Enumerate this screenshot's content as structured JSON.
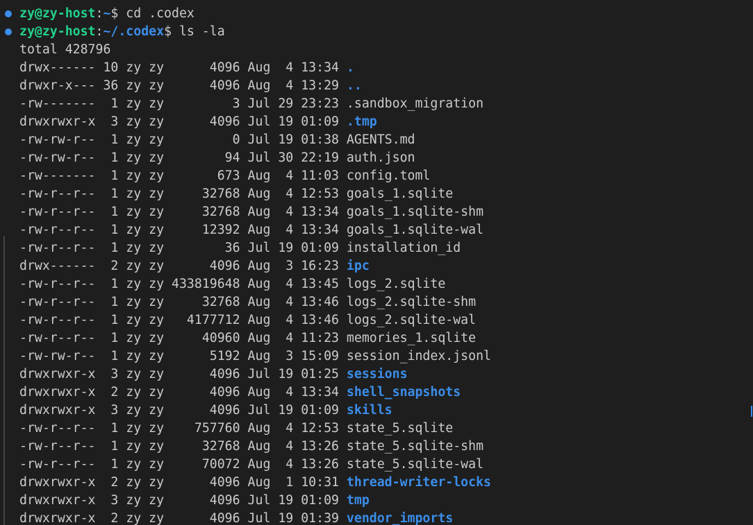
{
  "prompt": {
    "user_host": "zy@zy-host",
    "sep": ":"
  },
  "commands": [
    {
      "path": "~",
      "cmd": "$ cd .codex"
    },
    {
      "path": "~/.codex",
      "cmd": "$ ls -la"
    }
  ],
  "total_line": "total 428796",
  "entries": [
    {
      "perm": "drwx------",
      "links": "10",
      "owner": "zy",
      "group": "zy",
      "size": "4096",
      "month": "Aug",
      "day": "4",
      "time": "13:34",
      "name": ".",
      "is_dir": true
    },
    {
      "perm": "drwxr-x---",
      "links": "36",
      "owner": "zy",
      "group": "zy",
      "size": "4096",
      "month": "Aug",
      "day": "4",
      "time": "13:29",
      "name": "..",
      "is_dir": true
    },
    {
      "perm": "-rw-------",
      "links": "1",
      "owner": "zy",
      "group": "zy",
      "size": "3",
      "month": "Jul",
      "day": "29",
      "time": "23:23",
      "name": ".sandbox_migration",
      "is_dir": false
    },
    {
      "perm": "drwxrwxr-x",
      "links": "3",
      "owner": "zy",
      "group": "zy",
      "size": "4096",
      "month": "Jul",
      "day": "19",
      "time": "01:09",
      "name": ".tmp",
      "is_dir": true
    },
    {
      "perm": "-rw-rw-r--",
      "links": "1",
      "owner": "zy",
      "group": "zy",
      "size": "0",
      "month": "Jul",
      "day": "19",
      "time": "01:38",
      "name": "AGENTS.md",
      "is_dir": false
    },
    {
      "perm": "-rw-rw-r--",
      "links": "1",
      "owner": "zy",
      "group": "zy",
      "size": "94",
      "month": "Jul",
      "day": "30",
      "time": "22:19",
      "name": "auth.json",
      "is_dir": false
    },
    {
      "perm": "-rw-------",
      "links": "1",
      "owner": "zy",
      "group": "zy",
      "size": "673",
      "month": "Aug",
      "day": "4",
      "time": "11:03",
      "name": "config.toml",
      "is_dir": false
    },
    {
      "perm": "-rw-r--r--",
      "links": "1",
      "owner": "zy",
      "group": "zy",
      "size": "32768",
      "month": "Aug",
      "day": "4",
      "time": "12:53",
      "name": "goals_1.sqlite",
      "is_dir": false
    },
    {
      "perm": "-rw-r--r--",
      "links": "1",
      "owner": "zy",
      "group": "zy",
      "size": "32768",
      "month": "Aug",
      "day": "4",
      "time": "13:34",
      "name": "goals_1.sqlite-shm",
      "is_dir": false
    },
    {
      "perm": "-rw-r--r--",
      "links": "1",
      "owner": "zy",
      "group": "zy",
      "size": "12392",
      "month": "Aug",
      "day": "4",
      "time": "13:34",
      "name": "goals_1.sqlite-wal",
      "is_dir": false
    },
    {
      "perm": "-rw-r--r--",
      "links": "1",
      "owner": "zy",
      "group": "zy",
      "size": "36",
      "month": "Jul",
      "day": "19",
      "time": "01:09",
      "name": "installation_id",
      "is_dir": false
    },
    {
      "perm": "drwx------",
      "links": "2",
      "owner": "zy",
      "group": "zy",
      "size": "4096",
      "month": "Aug",
      "day": "3",
      "time": "16:23",
      "name": "ipc",
      "is_dir": true
    },
    {
      "perm": "-rw-r--r--",
      "links": "1",
      "owner": "zy",
      "group": "zy",
      "size": "433819648",
      "month": "Aug",
      "day": "4",
      "time": "13:45",
      "name": "logs_2.sqlite",
      "is_dir": false
    },
    {
      "perm": "-rw-r--r--",
      "links": "1",
      "owner": "zy",
      "group": "zy",
      "size": "32768",
      "month": "Aug",
      "day": "4",
      "time": "13:46",
      "name": "logs_2.sqlite-shm",
      "is_dir": false
    },
    {
      "perm": "-rw-r--r--",
      "links": "1",
      "owner": "zy",
      "group": "zy",
      "size": "4177712",
      "month": "Aug",
      "day": "4",
      "time": "13:46",
      "name": "logs_2.sqlite-wal",
      "is_dir": false
    },
    {
      "perm": "-rw-r--r--",
      "links": "1",
      "owner": "zy",
      "group": "zy",
      "size": "40960",
      "month": "Aug",
      "day": "4",
      "time": "11:23",
      "name": "memories_1.sqlite",
      "is_dir": false
    },
    {
      "perm": "-rw-rw-r--",
      "links": "1",
      "owner": "zy",
      "group": "zy",
      "size": "5192",
      "month": "Aug",
      "day": "3",
      "time": "15:09",
      "name": "session_index.jsonl",
      "is_dir": false
    },
    {
      "perm": "drwxrwxr-x",
      "links": "3",
      "owner": "zy",
      "group": "zy",
      "size": "4096",
      "month": "Jul",
      "day": "19",
      "time": "01:25",
      "name": "sessions",
      "is_dir": true
    },
    {
      "perm": "drwxrwxr-x",
      "links": "2",
      "owner": "zy",
      "group": "zy",
      "size": "4096",
      "month": "Aug",
      "day": "4",
      "time": "13:34",
      "name": "shell_snapshots",
      "is_dir": true
    },
    {
      "perm": "drwxrwxr-x",
      "links": "3",
      "owner": "zy",
      "group": "zy",
      "size": "4096",
      "month": "Jul",
      "day": "19",
      "time": "01:09",
      "name": "skills",
      "is_dir": true
    },
    {
      "perm": "-rw-r--r--",
      "links": "1",
      "owner": "zy",
      "group": "zy",
      "size": "757760",
      "month": "Aug",
      "day": "4",
      "time": "12:53",
      "name": "state_5.sqlite",
      "is_dir": false
    },
    {
      "perm": "-rw-r--r--",
      "links": "1",
      "owner": "zy",
      "group": "zy",
      "size": "32768",
      "month": "Aug",
      "day": "4",
      "time": "13:26",
      "name": "state_5.sqlite-shm",
      "is_dir": false
    },
    {
      "perm": "-rw-r--r--",
      "links": "1",
      "owner": "zy",
      "group": "zy",
      "size": "70072",
      "month": "Aug",
      "day": "4",
      "time": "13:26",
      "name": "state_5.sqlite-wal",
      "is_dir": false
    },
    {
      "perm": "drwxrwxr-x",
      "links": "2",
      "owner": "zy",
      "group": "zy",
      "size": "4096",
      "month": "Aug",
      "day": "1",
      "time": "10:31",
      "name": "thread-writer-locks",
      "is_dir": true
    },
    {
      "perm": "drwxrwxr-x",
      "links": "3",
      "owner": "zy",
      "group": "zy",
      "size": "4096",
      "month": "Jul",
      "day": "19",
      "time": "01:09",
      "name": "tmp",
      "is_dir": true
    },
    {
      "perm": "drwxrwxr-x",
      "links": "2",
      "owner": "zy",
      "group": "zy",
      "size": "4096",
      "month": "Jul",
      "day": "19",
      "time": "01:39",
      "name": "vendor_imports",
      "is_dir": true
    }
  ],
  "colors": {
    "background": "#1e1e1e",
    "foreground": "#cccccc",
    "user_host": "#23d18b",
    "path": "#3b8eea",
    "directory": "#3b8eea",
    "marker": "#3b8eea"
  }
}
